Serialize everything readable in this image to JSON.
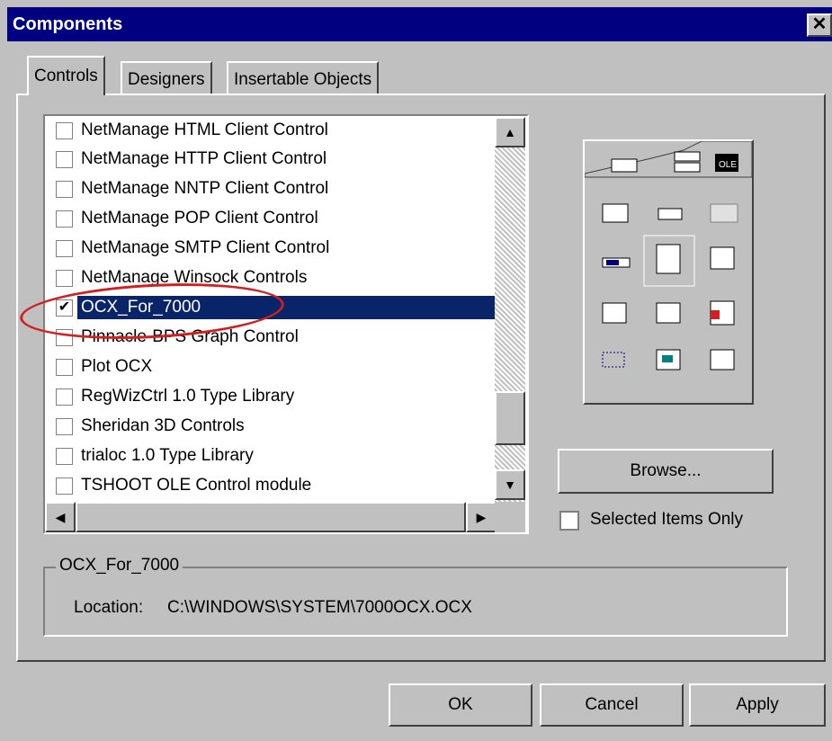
{
  "window": {
    "title": "Components",
    "close_label": "✕"
  },
  "tabs": [
    {
      "label": "Controls"
    },
    {
      "label": "Designers"
    },
    {
      "label": "Insertable Objects"
    }
  ],
  "controls_list": {
    "items": [
      {
        "label": "NetManage HTML Client Control",
        "checked": false
      },
      {
        "label": "NetManage HTTP Client Control",
        "checked": false
      },
      {
        "label": "NetManage NNTP Client Control",
        "checked": false
      },
      {
        "label": "NetManage POP Client Control",
        "checked": false
      },
      {
        "label": "NetManage SMTP Client Control",
        "checked": false
      },
      {
        "label": "NetManage Winsock Controls",
        "checked": false
      },
      {
        "label": "OCX_For_7000",
        "checked": true,
        "selected": true
      },
      {
        "label": "Pinnacle-BPS Graph Control",
        "checked": false
      },
      {
        "label": "Plot OCX",
        "checked": false
      },
      {
        "label": "RegWizCtrl 1.0 Type Library",
        "checked": false
      },
      {
        "label": "Sheridan 3D Controls",
        "checked": false
      },
      {
        "label": "trialoc 1.0 Type Library",
        "checked": false
      },
      {
        "label": "TSHOOT OLE Control module",
        "checked": false
      }
    ]
  },
  "buttons": {
    "browse": "Browse...",
    "ok": "OK",
    "cancel": "Cancel",
    "apply": "Apply"
  },
  "selected_items_only": {
    "label": "Selected Items Only",
    "checked": false
  },
  "details": {
    "group_title": "OCX_For_7000",
    "location_label": "Location:",
    "location_value": "C:\\WINDOWS\\SYSTEM\\7000OCX.OCX"
  },
  "colors": {
    "title_bar": "#000080",
    "selection": "#0a246a",
    "face": "#c0c0c0",
    "highlight_ellipse": "#d02020"
  }
}
